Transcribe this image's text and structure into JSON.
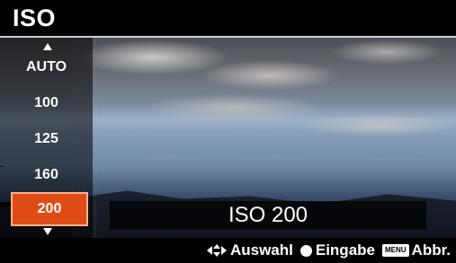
{
  "menu": {
    "title": "ISO"
  },
  "iso_list": {
    "items": [
      {
        "label": "AUTO"
      },
      {
        "label": "100"
      },
      {
        "label": "125"
      },
      {
        "label": "160"
      },
      {
        "label": "200"
      }
    ],
    "selected_label": "200"
  },
  "value_display": {
    "text": "ISO 200"
  },
  "footer": {
    "select_label": "Auswahl",
    "enter_label": "Eingabe",
    "menu_key_label": "MENU",
    "cancel_label": "Abbr."
  },
  "colors": {
    "highlight": "#e04c16",
    "highlight_border": "#ffb08a"
  },
  "icons": [
    "arrow-up-icon",
    "arrow-down-icon",
    "nav-arrows-icon",
    "circle-button-icon",
    "menu-button-icon"
  ]
}
